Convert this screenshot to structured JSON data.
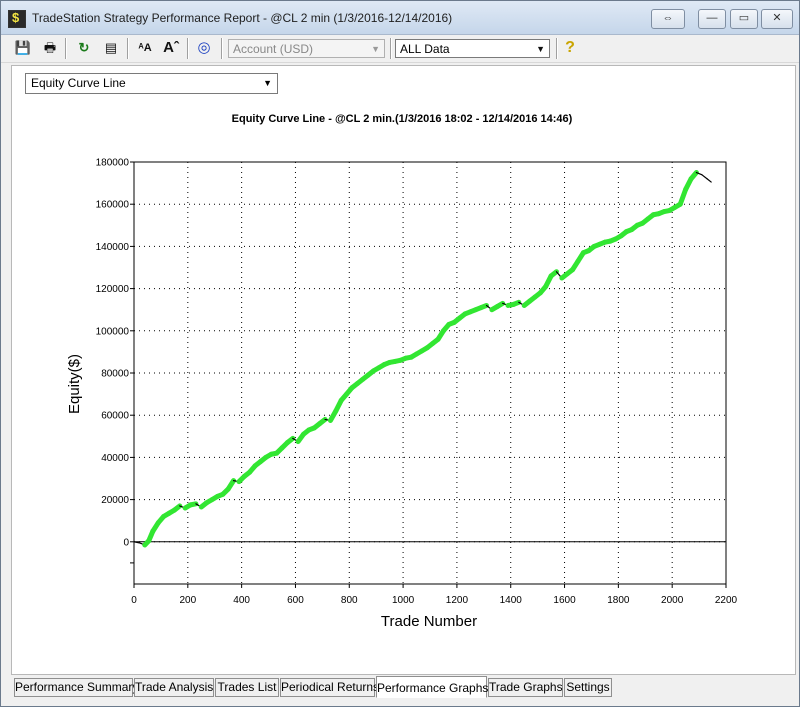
{
  "window": {
    "title": "TradeStation Strategy Performance Report - @CL 2 min (1/3/2016-12/14/2016)"
  },
  "toolbar": {
    "icons": [
      "save-icon",
      "print-icon",
      "refresh-icon",
      "properties-icon",
      "font-smaller-icon",
      "font-larger-icon",
      "target-icon",
      "help-icon"
    ],
    "account_combo": "Account (USD)",
    "data_range_combo": "ALL Data"
  },
  "graph_select": {
    "value": "Equity Curve Line"
  },
  "tabs": [
    {
      "label": "Performance Summary"
    },
    {
      "label": "Trade Analysis"
    },
    {
      "label": "Trades List"
    },
    {
      "label": "Periodical Returns"
    },
    {
      "label": "Performance Graphs",
      "active": true
    },
    {
      "label": "Trade Graphs"
    },
    {
      "label": "Settings"
    }
  ],
  "chart_data": {
    "type": "line",
    "title": "Equity Curve Line - @CL 2 min.(1/3/2016 18:02 - 12/14/2016 14:46)",
    "xlabel": "Trade Number",
    "ylabel": "Equity($)",
    "xlim": [
      0,
      2200
    ],
    "ylim": [
      -20000,
      180000
    ],
    "xticks": [
      0,
      200,
      400,
      600,
      800,
      1000,
      1200,
      1400,
      1600,
      1800,
      2000,
      2200
    ],
    "yticks": [
      0,
      20000,
      40000,
      60000,
      80000,
      100000,
      120000,
      140000,
      160000,
      180000
    ],
    "grid": true,
    "colors": {
      "new_high": "#32e632",
      "drawdown": "#000000"
    },
    "series": [
      {
        "values_x": [
          0,
          20,
          40,
          55,
          70,
          90,
          110,
          130,
          150,
          170,
          190,
          210,
          230,
          250,
          270,
          290,
          310,
          330,
          350,
          370,
          390,
          410,
          430,
          450,
          470,
          490,
          510,
          530,
          550,
          570,
          590,
          610,
          630,
          650,
          670,
          690,
          710,
          730,
          750,
          770,
          790,
          810,
          830,
          850,
          870,
          890,
          910,
          930,
          950,
          970,
          990,
          1010,
          1030,
          1050,
          1070,
          1090,
          1110,
          1130,
          1150,
          1170,
          1190,
          1210,
          1230,
          1250,
          1270,
          1290,
          1310,
          1330,
          1350,
          1370,
          1390,
          1410,
          1430,
          1450,
          1470,
          1490,
          1510,
          1530,
          1550,
          1570,
          1590,
          1610,
          1630,
          1650,
          1670,
          1690,
          1710,
          1730,
          1750,
          1770,
          1790,
          1810,
          1830,
          1850,
          1870,
          1890,
          1910,
          1930,
          1950,
          1970,
          1990,
          2010,
          2030,
          2050,
          2070,
          2090,
          2110,
          2130,
          2145
        ],
        "values_y": [
          0,
          -500,
          -1500,
          500,
          5000,
          9000,
          12000,
          13500,
          15000,
          17000,
          16000,
          17500,
          18000,
          16500,
          18500,
          20000,
          21500,
          22500,
          25000,
          29000,
          28500,
          31000,
          33000,
          36000,
          38000,
          40000,
          41500,
          42000,
          44500,
          47000,
          49000,
          47500,
          51000,
          53000,
          54000,
          56000,
          58000,
          57500,
          62000,
          67000,
          70000,
          73000,
          75000,
          77000,
          79000,
          81000,
          82500,
          84000,
          85000,
          85500,
          86000,
          87000,
          87500,
          89000,
          90500,
          92000,
          94000,
          96000,
          100000,
          103000,
          104000,
          106000,
          108000,
          109000,
          110000,
          111000,
          112000,
          110000,
          111500,
          113000,
          112000,
          112500,
          113500,
          112000,
          114000,
          116000,
          118000,
          121000,
          126000,
          128000,
          125000,
          127000,
          129000,
          133000,
          137000,
          138000,
          140000,
          141000,
          142000,
          142500,
          143500,
          145000,
          147000,
          148000,
          150000,
          151000,
          153000,
          155000,
          155500,
          156500,
          157000,
          158500,
          160000,
          167000,
          172000,
          175000,
          174000,
          172000,
          170500
        ],
        "new_high": [
          1,
          0,
          0,
          1,
          1,
          1,
          1,
          1,
          1,
          1,
          0,
          1,
          1,
          0,
          1,
          1,
          1,
          1,
          1,
          1,
          0,
          1,
          1,
          1,
          1,
          1,
          1,
          1,
          1,
          1,
          1,
          0,
          1,
          1,
          1,
          1,
          1,
          0,
          1,
          1,
          1,
          1,
          1,
          1,
          1,
          1,
          1,
          1,
          1,
          1,
          1,
          1,
          1,
          1,
          1,
          1,
          1,
          1,
          1,
          1,
          1,
          1,
          1,
          1,
          1,
          1,
          1,
          0,
          1,
          1,
          0,
          1,
          1,
          0,
          1,
          1,
          1,
          1,
          1,
          1,
          0,
          1,
          1,
          1,
          1,
          1,
          1,
          1,
          1,
          1,
          1,
          1,
          1,
          1,
          1,
          1,
          1,
          1,
          1,
          1,
          1,
          1,
          1,
          1,
          1,
          1,
          0,
          0,
          0
        ]
      }
    ]
  }
}
